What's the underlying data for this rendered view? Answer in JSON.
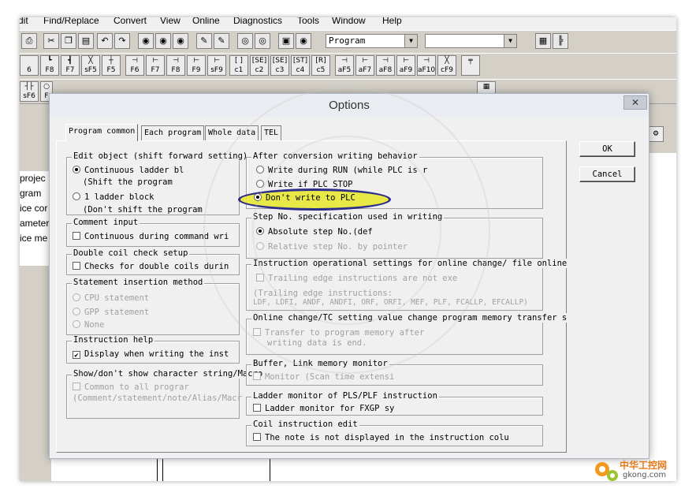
{
  "menu": [
    "dit",
    "Find/Replace",
    "Convert",
    "View",
    "Online",
    "Diagnostics",
    "Tools",
    "Window",
    "Help"
  ],
  "toolbar": {
    "combo1_value": "Program",
    "combo2_value": "",
    "fkeys_row": [
      {
        "glyph": "",
        "label": "6"
      },
      {
        "glyph": "┗",
        "label": "F8"
      },
      {
        "glyph": "┫",
        "label": "F7"
      },
      {
        "glyph": "╳",
        "label": "sF5"
      },
      {
        "glyph": "┼",
        "label": "F5"
      },
      {
        "glyph": "⊣",
        "label": "F6"
      },
      {
        "glyph": "⊢",
        "label": "F7"
      },
      {
        "glyph": "⊣",
        "label": "F8"
      },
      {
        "glyph": "⊢",
        "label": "F9"
      },
      {
        "glyph": "⊢",
        "label": "sF9"
      },
      {
        "glyph": "[ ]",
        "label": "c1"
      },
      {
        "glyph": "[SE]",
        "label": "c2"
      },
      {
        "glyph": "[SE]",
        "label": "c3"
      },
      {
        "glyph": "[ST]",
        "label": "c4"
      },
      {
        "glyph": "[R]",
        "label": "c5"
      },
      {
        "glyph": "⊣",
        "label": "aF5"
      },
      {
        "glyph": "⊢",
        "label": "aF7"
      },
      {
        "glyph": "⊣",
        "label": "aF8"
      },
      {
        "glyph": "⊢",
        "label": "aF9"
      },
      {
        "glyph": "⊣",
        "label": "aF10"
      },
      {
        "glyph": "╳",
        "label": "cF9"
      }
    ],
    "row3_labels": [
      "sF6",
      "F"
    ]
  },
  "left_pane": [
    "projec",
    "gram",
    "ice cor",
    "ameter",
    "ice me"
  ],
  "dialog": {
    "title": "Options",
    "close_glyph": "✕",
    "tabs": [
      "Program common",
      "Each program",
      "Whole data",
      "TEL"
    ],
    "buttons": {
      "ok": "OK",
      "cancel": "Cancel"
    },
    "edit_object": {
      "caption": "Edit object (shift forward setting)",
      "opt1": "Continuous ladder bl",
      "opt1_sub": "(Shift the program",
      "opt2": "1 ladder block",
      "opt2_sub": "(Don't shift the program"
    },
    "comment_input": {
      "caption": "Comment input",
      "check": "Continuous during command wri"
    },
    "double_coil": {
      "caption": "Double coil check setup",
      "check": "Checks for double coils durin"
    },
    "statement_insertion": {
      "caption": "Statement insertion method",
      "opt1": "CPU statement",
      "opt2": "GPP statement",
      "opt3": "None"
    },
    "instruction_help": {
      "caption": "Instruction help",
      "check": "Display when writing the inst"
    },
    "show_char": {
      "caption": "Show/don't show character string/Macro",
      "check": "Common to all prograr",
      "sub": "(Comment/statement/note/Alias/Macr"
    },
    "after_conversion": {
      "caption": "After conversion writing behavior",
      "opt1": "Write during RUN (while PLC is r",
      "opt2": "Write if PLC STOP",
      "opt3": "Don't write to PLC"
    },
    "step_no": {
      "caption": "Step No. specification used in writing",
      "opt1": "Absolute step No.(def",
      "opt2": "Relative step No. by pointer"
    },
    "instruction_op": {
      "caption": "Instruction operational settings for online change/ file online",
      "check": "Trailing edge instructions are not exe",
      "sub1": "(Trailing edge instructions:",
      "sub2": "LDF, LDFI, ANDF, ANDFI, ORF, ORFI, MEF, PLF, FCALLP, EFCALLP)"
    },
    "online_change": {
      "caption": "Online change/TC setting value change program memory transfer s",
      "check": "Transfer to program memory after",
      "sub": "writing data is end."
    },
    "buffer_link": {
      "caption": "Buffer, Link memory monitor",
      "check": "Monitor (Scan time extensi"
    },
    "ladder_monitor": {
      "caption": "Ladder monitor of PLS/PLF instruction",
      "check": "Ladder monitor for FXGP sy"
    },
    "coil_edit": {
      "caption": "Coil instruction edit",
      "check": "The note is not displayed in the instruction colu"
    }
  },
  "watermark": {
    "site_cn": "中华工控网",
    "site_url": "gkong.com"
  }
}
